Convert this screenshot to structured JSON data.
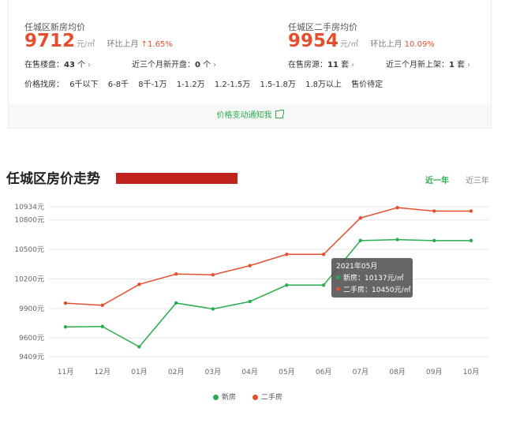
{
  "summary": {
    "new_home": {
      "title": "任城区新房均价",
      "price": "9712",
      "unit": "元/㎡",
      "change_label": "环比上月",
      "change_value": "↑1.65%",
      "on_sale_label": "在售楼盘：",
      "on_sale_value": "43",
      "on_sale_unit": "个",
      "recent_label": "近三个月新开盘：",
      "recent_value": "0",
      "recent_unit": "个"
    },
    "second_hand": {
      "title": "任城区二手房均价",
      "price": "9954",
      "unit": "元/㎡",
      "change_label": "环比上月",
      "change_value": "10.09%",
      "on_sale_label": "在售房源：",
      "on_sale_value": "11",
      "on_sale_unit": "套",
      "recent_label": "近三个月新上架：",
      "recent_value": "1",
      "recent_unit": "套"
    },
    "price_filter": {
      "label": "价格找房：",
      "options": [
        "6千以下",
        "6-8千",
        "8千-1万",
        "1-1.2万",
        "1.2-1.5万",
        "1.5-1.8万",
        "1.8万以上",
        "售价待定"
      ]
    },
    "notify_text": "价格变动通知我"
  },
  "trend": {
    "title": "任城区房价走势",
    "tabs": [
      "近一年",
      "近三年"
    ],
    "active_tab": "近一年"
  },
  "tooltip": {
    "title": "2021年05月",
    "new_line": "新房：10137元/㎡",
    "second_line": "二手房：10450元/㎡"
  },
  "colors": {
    "new": "#2aad4c",
    "second": "#e4502f",
    "accent_red": "#c0231d"
  },
  "chart_data": {
    "type": "line",
    "categories": [
      "11月",
      "12月",
      "01月",
      "02月",
      "03月",
      "04月",
      "05月",
      "06月",
      "07月",
      "08月",
      "09月",
      "10月"
    ],
    "y_ticks": [
      9409,
      9600,
      9900,
      10200,
      10500,
      10800,
      10934
    ],
    "y_tick_suffix": "元",
    "ylim": [
      9409,
      10934
    ],
    "grid": true,
    "legend_position": "bottom-center",
    "series": [
      {
        "name": "新房",
        "values": [
          9712,
          9716,
          9510,
          9955,
          9895,
          9970,
          10137,
          10137,
          10590,
          10600,
          10590,
          10590
        ]
      },
      {
        "name": "二手房",
        "values": [
          9954,
          9932,
          10145,
          10250,
          10242,
          10335,
          10450,
          10450,
          10820,
          10925,
          10890,
          10890
        ]
      }
    ]
  }
}
